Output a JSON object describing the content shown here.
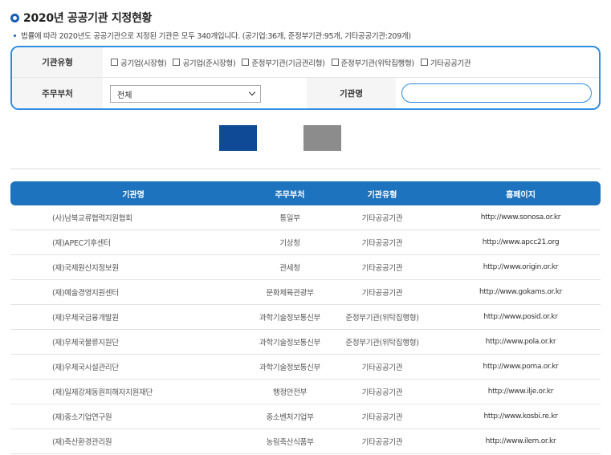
{
  "page_title": "2020년 공공기관 지정현황",
  "description": "법률에 따라 2020년도 공공기관으로 지정된 기관은 모두 340개입니다. (공기업:36개, 준정부기관:95개, 기타공공기관:209개)",
  "search": {
    "type_label": "기관유형",
    "checkboxes": [
      "공기업(시장형)",
      "공기업(준시장형)",
      "준정부기관(기금관리형)",
      "준정부기관(위탁집행형)",
      "기타공공기관"
    ],
    "ministry_label": "주무부처",
    "ministry_selected": "전체",
    "name_label": "기관명",
    "name_value": ""
  },
  "table": {
    "headers": [
      "기관명",
      "주무부처",
      "기관유형",
      "홈페이지"
    ],
    "rows": [
      [
        "(사)남북교류협력지원협회",
        "통일부",
        "기타공공기관",
        "http://www.sonosa.or.kr"
      ],
      [
        "(재)APEC기후센터",
        "기상청",
        "기타공공기관",
        "http://www.apcc21.org"
      ],
      [
        "(재)국제원산지정보원",
        "관세청",
        "기타공공기관",
        "http://www.origin.or.kr"
      ],
      [
        "(재)예술경영지원센터",
        "문화체육관광부",
        "기타공공기관",
        "http://www.gokams.or.kr"
      ],
      [
        "(재)우체국금융개발원",
        "과학기술정보통신부",
        "준정부기관(위탁집행형)",
        "http://www.posid.or.kr"
      ],
      [
        "(재)우체국물류지원단",
        "과학기술정보통신부",
        "준정부기관(위탁집행형)",
        "http://www.pola.or.kr"
      ],
      [
        "(재)우체국시설관리단",
        "과학기술정보통신부",
        "기타공공기관",
        "http://www.poma.or.kr"
      ],
      [
        "(재)일제강제동원피해자지원재단",
        "행정안전부",
        "기타공공기관",
        "http://www.ilje.or.kr"
      ],
      [
        "(재)중소기업연구원",
        "중소벤처기업부",
        "기타공공기관",
        "http://www.kosbi.re.kr"
      ],
      [
        "(재)축산환경관리원",
        "농림축산식품부",
        "기타공공기관",
        "http://www.ilem.or.kr"
      ]
    ]
  },
  "colors": {
    "accent": "#1e73be",
    "search_button": "#0e4a96",
    "reset_button": "#8c8c8c",
    "border": "#2f8ee3"
  }
}
